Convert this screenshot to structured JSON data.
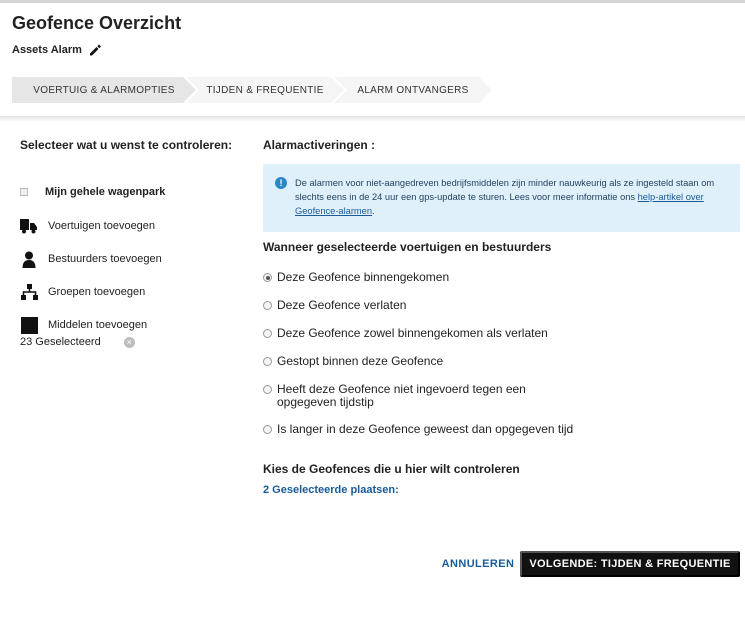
{
  "header": {
    "title": "Geofence Overzicht",
    "subtitle": "Assets Alarm"
  },
  "steps": [
    {
      "label": "VOERTUIG & ALARMOPTIES",
      "active": true
    },
    {
      "label": "TIJDEN & FREQUENTIE",
      "active": false
    },
    {
      "label": "ALARM ONTVANGERS",
      "active": false
    }
  ],
  "left": {
    "title": "Selecteer wat u wenst te controleren:",
    "whole_fleet": "Mijn gehele wagenpark",
    "items": [
      {
        "label": "Voertuigen toevoegen",
        "icon": "truck-icon"
      },
      {
        "label": "Bestuurders toevoegen",
        "icon": "person-icon"
      },
      {
        "label": "Groepen toevoegen",
        "icon": "hierarchy-icon"
      },
      {
        "label": "Middelen toevoegen",
        "icon": "square-icon"
      }
    ],
    "selected_count": "23 Geselecteerd"
  },
  "right": {
    "title": "Alarmactiveringen :",
    "info_text": "De alarmen voor niet-aangedreven bedrijfsmiddelen zijn minder nauwkeurig als ze ingesteld staan om slechts eens in de 24 uur een gps-update te sturen. Lees voor meer informatie ons ",
    "info_link": "help-artikel over Geofence-alarmen",
    "info_end": ".",
    "when_title": "Wanneer geselecteerde voertuigen en bestuurders",
    "options": [
      {
        "label": "Deze Geofence binnengekomen",
        "checked": true
      },
      {
        "label": "Deze Geofence verlaten",
        "checked": false
      },
      {
        "label": "Deze Geofence zowel binnengekomen als verlaten",
        "checked": false
      },
      {
        "label": "Gestopt binnen deze Geofence",
        "checked": false
      },
      {
        "label": "Heeft deze Geofence niet ingevoerd tegen een opgegeven tijdstip",
        "checked": false
      },
      {
        "label": "Is langer in deze Geofence geweest dan opgegeven tijd",
        "checked": false
      }
    ],
    "geofence_title": "Kies de Geofences die u hier wilt controleren",
    "places_link": "2 Geselecteerde plaatsen:"
  },
  "footer": {
    "cancel": "ANNULEREN",
    "next": "VOLGENDE: TIJDEN & FREQUENTIE"
  },
  "colors": {
    "link": "#1a5a99",
    "info_bg": "#dff0fb",
    "step_active": "#e6e6e6",
    "step_inactive": "#f5f5f5",
    "primary_button": "#111111"
  }
}
